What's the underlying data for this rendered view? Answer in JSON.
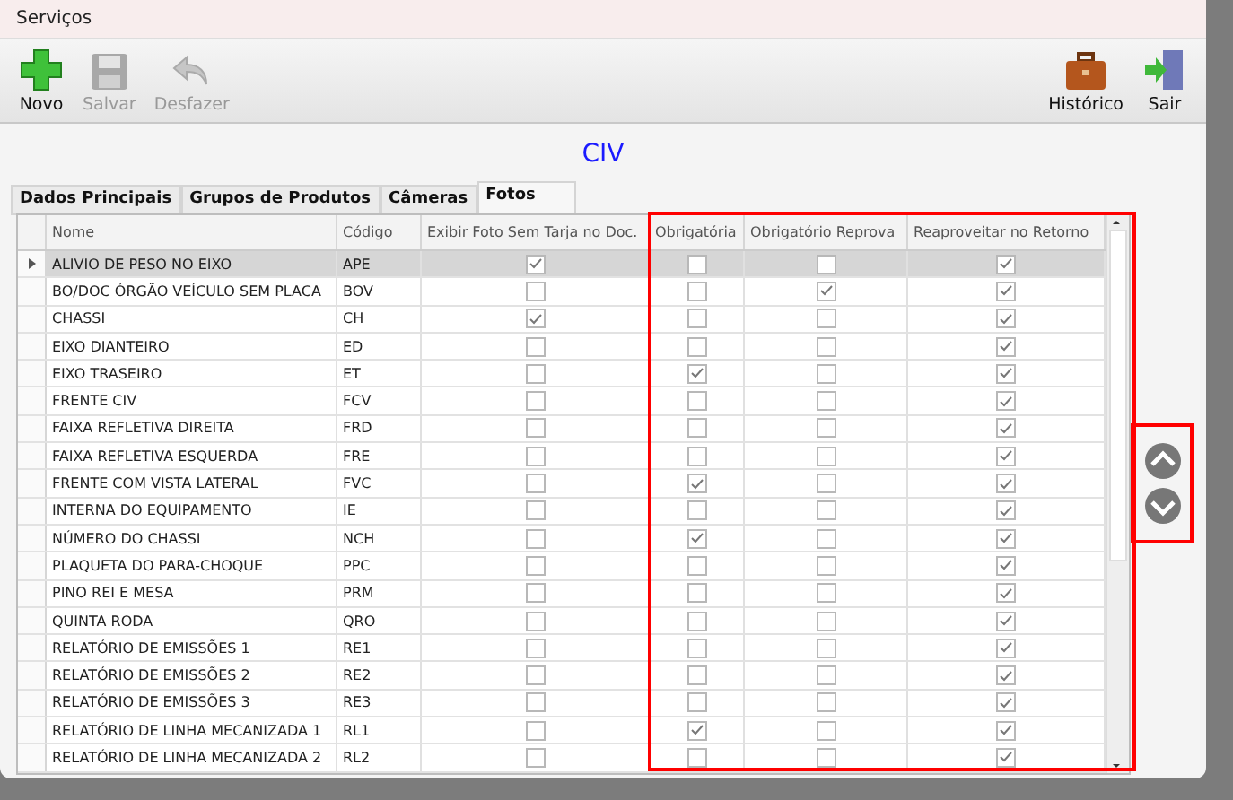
{
  "window": {
    "title": "Serviços"
  },
  "toolbar": {
    "left": [
      {
        "label": "Novo",
        "kind": "plus",
        "disabled": false
      },
      {
        "label": "Salvar",
        "kind": "save",
        "disabled": true
      },
      {
        "label": "Desfazer",
        "kind": "undo",
        "disabled": true
      }
    ],
    "right": [
      {
        "label": "Histórico",
        "kind": "briefcase",
        "disabled": false
      },
      {
        "label": "Sair",
        "kind": "exit",
        "disabled": false
      }
    ]
  },
  "heading": "CIV",
  "tabs": [
    {
      "label": "Dados Principais",
      "selected": false
    },
    {
      "label": "Grupos de Produtos",
      "selected": false
    },
    {
      "label": "Câmeras",
      "selected": false
    },
    {
      "label": "Fotos",
      "selected": true
    }
  ],
  "table": {
    "columns": [
      "Nome",
      "Código",
      "Exibir Foto Sem Tarja no Doc.",
      "Obrigatória",
      "Obrigatório Reprova",
      "Reaproveitar no Retorno"
    ],
    "rows": [
      {
        "name": "ALIVIO DE PESO NO EIXO",
        "code": "APE",
        "selected": true,
        "checks": [
          true,
          false,
          false,
          true
        ]
      },
      {
        "name": "BO/DOC ÓRGÃO VEÍCULO SEM PLACA",
        "code": "BOV",
        "selected": false,
        "checks": [
          false,
          false,
          true,
          true
        ]
      },
      {
        "name": "CHASSI",
        "code": "CH",
        "selected": false,
        "checks": [
          true,
          false,
          false,
          true
        ]
      },
      {
        "name": "EIXO DIANTEIRO",
        "code": "ED",
        "selected": false,
        "checks": [
          false,
          false,
          false,
          true
        ]
      },
      {
        "name": "EIXO TRASEIRO",
        "code": "ET",
        "selected": false,
        "checks": [
          false,
          true,
          false,
          true
        ]
      },
      {
        "name": "FRENTE CIV",
        "code": "FCV",
        "selected": false,
        "checks": [
          false,
          false,
          false,
          true
        ]
      },
      {
        "name": "FAIXA REFLETIVA DIREITA",
        "code": "FRD",
        "selected": false,
        "checks": [
          false,
          false,
          false,
          true
        ]
      },
      {
        "name": "FAIXA REFLETIVA ESQUERDA",
        "code": "FRE",
        "selected": false,
        "checks": [
          false,
          false,
          false,
          true
        ]
      },
      {
        "name": "FRENTE COM VISTA LATERAL",
        "code": "FVC",
        "selected": false,
        "checks": [
          false,
          true,
          false,
          true
        ]
      },
      {
        "name": "INTERNA DO EQUIPAMENTO",
        "code": "IE",
        "selected": false,
        "checks": [
          false,
          false,
          false,
          true
        ]
      },
      {
        "name": "NÚMERO DO CHASSI",
        "code": "NCH",
        "selected": false,
        "checks": [
          false,
          true,
          false,
          true
        ]
      },
      {
        "name": "PLAQUETA DO PARA-CHOQUE",
        "code": "PPC",
        "selected": false,
        "checks": [
          false,
          false,
          false,
          true
        ]
      },
      {
        "name": "PINO REI E MESA",
        "code": "PRM",
        "selected": false,
        "checks": [
          false,
          false,
          false,
          true
        ]
      },
      {
        "name": "QUINTA RODA",
        "code": "QRO",
        "selected": false,
        "checks": [
          false,
          false,
          false,
          true
        ]
      },
      {
        "name": "RELATÓRIO DE EMISSÕES 1",
        "code": "RE1",
        "selected": false,
        "checks": [
          false,
          false,
          false,
          true
        ]
      },
      {
        "name": "RELATÓRIO DE EMISSÕES 2",
        "code": "RE2",
        "selected": false,
        "checks": [
          false,
          false,
          false,
          true
        ]
      },
      {
        "name": "RELATÓRIO DE EMISSÕES 3",
        "code": "RE3",
        "selected": false,
        "checks": [
          false,
          false,
          false,
          true
        ]
      },
      {
        "name": "RELATÓRIO DE LINHA MECANIZADA 1",
        "code": "RL1",
        "selected": false,
        "checks": [
          false,
          true,
          false,
          true
        ]
      },
      {
        "name": "RELATÓRIO DE LINHA MECANIZADA 2",
        "code": "RL2",
        "selected": false,
        "checks": [
          false,
          false,
          false,
          true
        ]
      }
    ]
  }
}
